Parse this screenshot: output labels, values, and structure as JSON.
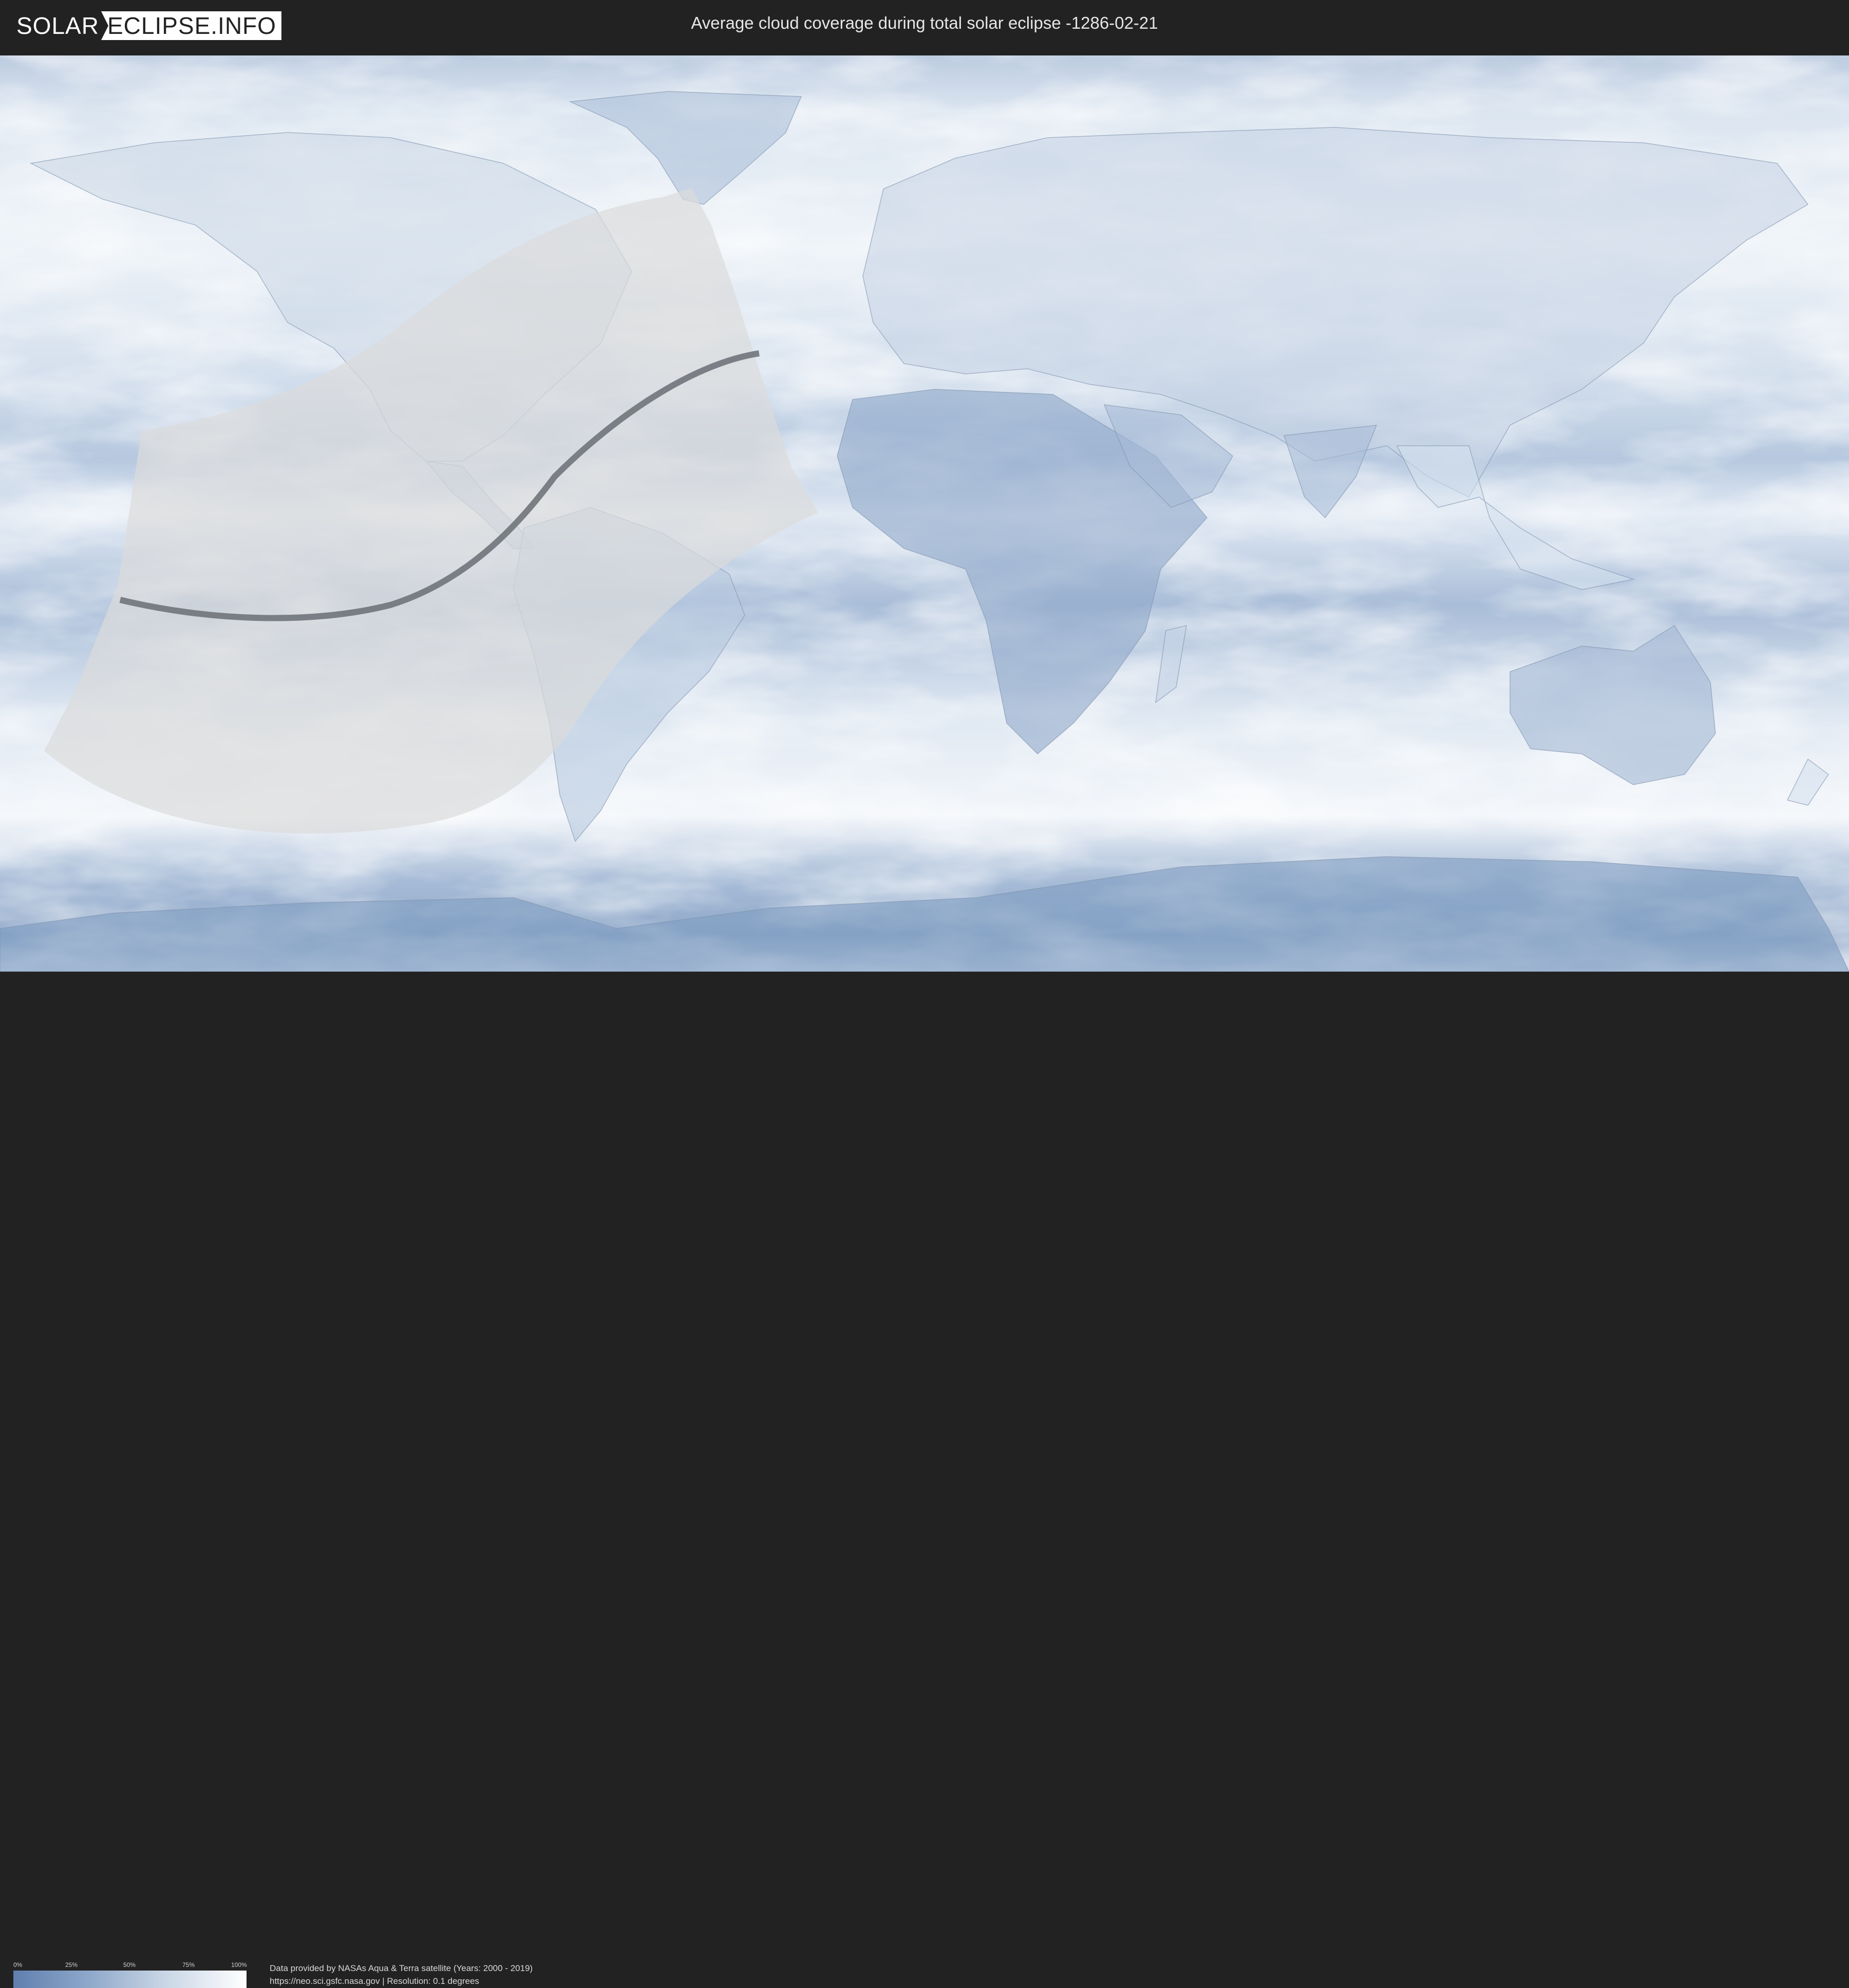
{
  "header": {
    "logo_part1": "SOLAR",
    "logo_part2": "ECLIPSE.INFO",
    "title": "Average cloud coverage during total solar eclipse -1286-02-21"
  },
  "legend": {
    "ticks": [
      "0%",
      "25%",
      "50%",
      "75%",
      "100%"
    ],
    "gradient_colors": [
      "#5f7fae",
      "#8aa5c8",
      "#c9d6e6",
      "#ffffff"
    ]
  },
  "credits": {
    "line1": "Data provided by NASAs Aqua & Terra satellite (Years: 2000 - 2019)",
    "line2": "https://neo.sci.gsfc.nasa.gov | Resolution: 0.1 degrees"
  },
  "colors": {
    "clear_sky": "#5f7fae",
    "cloudy": "#ffffff",
    "eclipse_zone": "#dcdcdc",
    "central_line": "#6a6e74",
    "background": "#222222"
  }
}
